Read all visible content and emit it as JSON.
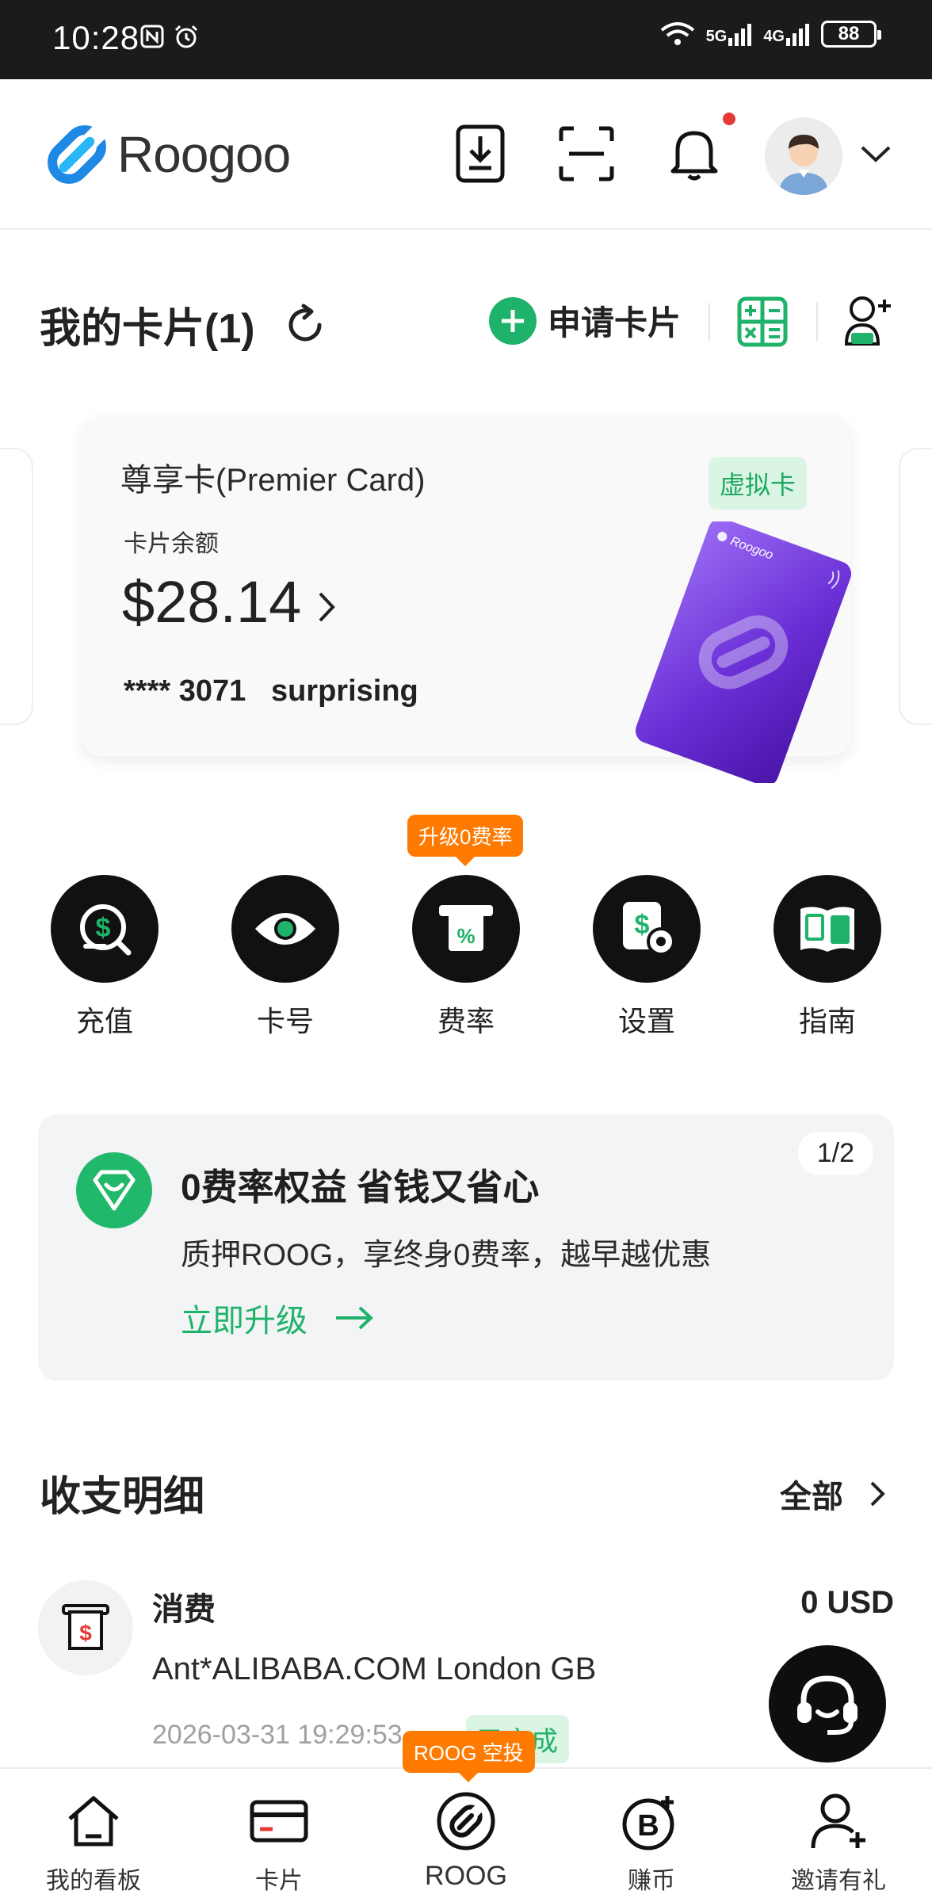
{
  "status_bar": {
    "time": "10:28",
    "battery": "88",
    "network_a": "5G",
    "network_b": "4G"
  },
  "header": {
    "brand": "Roogoo"
  },
  "my_cards": {
    "title": "我的卡片(1)",
    "apply_label": "申请卡片"
  },
  "card": {
    "name": "尊享卡(Premier Card)",
    "badge": "虚拟卡",
    "balance_label": "卡片余额",
    "balance": "$28.14",
    "number": "**** 3071",
    "nickname": "surprising",
    "art_brand": "Roogoo"
  },
  "actions": {
    "tip": "升级0费率",
    "items": [
      {
        "label": "充值",
        "icon": "recharge-dollar-icon"
      },
      {
        "label": "卡号",
        "icon": "eye-icon"
      },
      {
        "label": "费率",
        "icon": "fee-percent-icon"
      },
      {
        "label": "设置",
        "icon": "settings-dollar-gear-icon"
      },
      {
        "label": "指南",
        "icon": "guide-book-icon"
      }
    ]
  },
  "promo": {
    "title": "0费率权益 省钱又省心",
    "description": "质押ROOG，享终身0费率，越早越优惠",
    "link": "立即升级",
    "pager": "1/2"
  },
  "transactions": {
    "title": "收支明细",
    "all_label": "全部",
    "items": [
      {
        "type": "消费",
        "amount": "0 USD",
        "merchant": "Ant*ALIBABA.COM London GB",
        "time": "2026-03-31 19:29:53",
        "status": "已完成"
      }
    ]
  },
  "bottom_nav": {
    "airdrop_badge": "ROOG 空投",
    "items": [
      {
        "label": "我的看板",
        "icon": "home-icon"
      },
      {
        "label": "卡片",
        "icon": "card-icon"
      },
      {
        "label": "ROOG",
        "icon": "roog-logo-icon"
      },
      {
        "label": "赚币",
        "icon": "bitcoin-plus-icon"
      },
      {
        "label": "邀请有礼",
        "icon": "invite-user-icon"
      }
    ]
  },
  "colors": {
    "accent": "#1fb26a",
    "orange": "#ff7a00",
    "card_purple": "#6a2fd6",
    "dark": "#111111"
  }
}
